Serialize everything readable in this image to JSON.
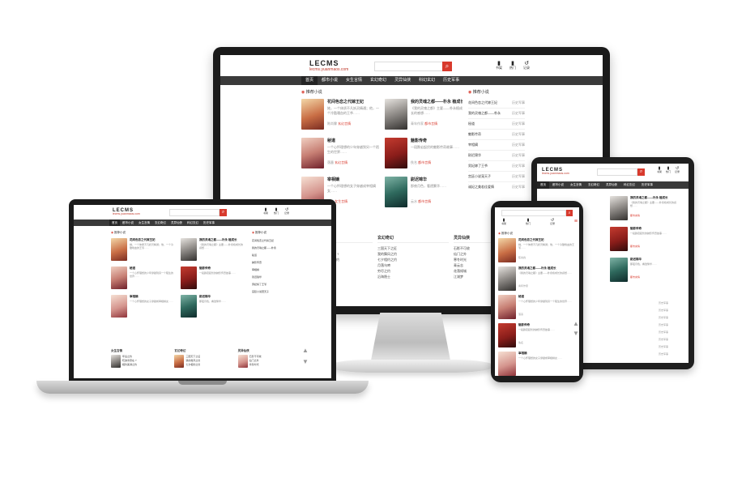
{
  "site": {
    "logo": "LECMS",
    "url": "lecms.yuanmaos.com",
    "search_icon": "search-icon",
    "header_icons": [
      {
        "icon": "book-icon",
        "label": "书架"
      },
      {
        "icon": "fire-icon",
        "label": "热门"
      },
      {
        "icon": "history-icon",
        "label": "记录"
      }
    ],
    "nav": [
      "首页",
      "都市小说",
      "女生言情",
      "玄幻奇幻",
      "灵异仙侠",
      "科幻玄幻",
      "历史军事"
    ],
    "recommend_title": "推荐小说",
    "ranking_title": "推荐小说",
    "accent": "#d83a2d",
    "nav_bg": "#3a3a3a"
  },
  "books": [
    {
      "title": "花间色恋之代嫁王妃",
      "desc": "她，一个体质不凡妖灵精通；他，一个冷酷嗜血的王爷……",
      "author": "陈尚霖",
      "tag": "玄幻言情",
      "status": "连载中"
    },
    {
      "title": "我的灵魂之都——朴永 植成长",
      "desc": "《我的灵魂之都》主要——朴永植成长的感想……",
      "author": "青年作家",
      "tag": "都市言情",
      "status": "连载中"
    },
    {
      "title": "秘道",
      "desc": "一个心怀理想的少年穿越到另一个陌生的世界……",
      "author": "落墨",
      "tag": "玄幻言情",
      "status": "连载中"
    },
    {
      "title": "魅影传奇",
      "desc": "一段跌宕起伏的魅影传奇故事……",
      "author": "佚名",
      "tag": "都市言情",
      "status": "连载中"
    },
    {
      "title": "宰相嫡",
      "desc": "一个心怀理想的女子穿越成宰相嫡女……",
      "author": "清风",
      "tag": "女生言情",
      "status": "连载中"
    },
    {
      "title": "尉迟锦华",
      "desc": "那夜月色，看透繁华……",
      "author": "云水",
      "tag": "都市言情",
      "status": "连载中"
    }
  ],
  "ranking": [
    {
      "title": "花间色恋之代嫁王妃",
      "author": "历史军事"
    },
    {
      "title": "我的灵魂之都——朴永",
      "author": "历史军事"
    },
    {
      "title": "秘道",
      "author": "历史军事"
    },
    {
      "title": "魅影传奇",
      "author": "历史军事"
    },
    {
      "title": "宰相嫡",
      "author": "历史军事"
    },
    {
      "title": "尉迟锦华",
      "author": "历史军事"
    },
    {
      "title": "男妃嫁了王爷",
      "author": "历史军事"
    },
    {
      "title": "宫廷小说宠天子",
      "author": "历史军事"
    },
    {
      "title": "诚妃之美若佳爱情",
      "author": "历史军事"
    }
  ],
  "columns": [
    {
      "title": "女生言情",
      "items": [
        "年后之约",
        "晓波寒意在 ?",
        "相约美满之约",
        "昂在佳之约",
        "帝后 ?",
        "青丝方阑"
      ]
    },
    {
      "title": "玄幻奇幻",
      "items": [
        "三国天下之征",
        "我的舞风之约",
        "七夕相约之约",
        "月落乌啼",
        "穷尽之约",
        "沿海隐士"
      ]
    },
    {
      "title": "灵异仙侠",
      "items": [
        "石影不可收",
        "仙门之外",
        "寒冬时光",
        "青云志",
        "花落倾城",
        "江湖梦"
      ]
    }
  ]
}
